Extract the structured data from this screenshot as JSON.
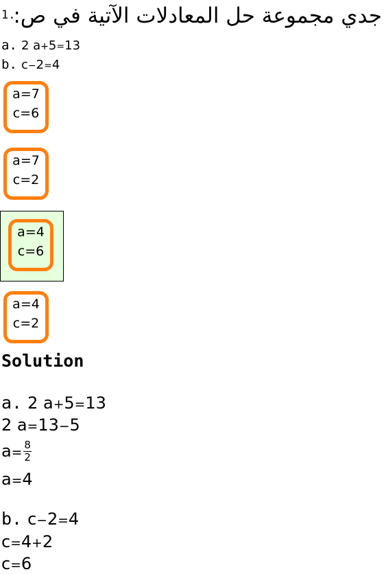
{
  "question": {
    "number": "1.",
    "text": "جدي مجموعة حل المعادلات الآتية في ص:"
  },
  "equations": [
    {
      "label": "a.",
      "lhs_coef": "2",
      "lhs_var": "a",
      "op": "+",
      "lhs_const": "5",
      "rhs": "13"
    },
    {
      "label": "b.",
      "lhs_var": "c",
      "op": "−",
      "lhs_const": "2",
      "rhs": "4"
    }
  ],
  "options": [
    {
      "a": "a=7",
      "c": "c=6",
      "selected": false
    },
    {
      "a": "a=7",
      "c": "c=2",
      "selected": false
    },
    {
      "a": "a=4",
      "c": "c=6",
      "selected": true
    },
    {
      "a": "a=4",
      "c": "c=2",
      "selected": false
    }
  ],
  "solution": {
    "title": "Solution",
    "part_a": {
      "label": "a.",
      "line1": {
        "coef": "2",
        "var": "a",
        "op": "+",
        "const": "5",
        "rhs": "13"
      },
      "line2": {
        "coef": "2",
        "var": "a",
        "rhs1": "13",
        "op": "−",
        "rhs2": "5"
      },
      "line3": {
        "var": "a",
        "num": "8",
        "den": "2"
      },
      "line4": {
        "var": "a",
        "value": "4"
      }
    },
    "part_b": {
      "label": "b.",
      "line1": {
        "var": "c",
        "op": "−",
        "const": "2",
        "rhs": "4"
      },
      "line2": {
        "var": "c",
        "rhs1": "4",
        "op": "+",
        "rhs2": "2"
      },
      "line3": {
        "var": "c",
        "value": "6"
      }
    }
  },
  "colors": {
    "option_border": "#ff7f0e",
    "selected_background": "#e6ffdd"
  }
}
